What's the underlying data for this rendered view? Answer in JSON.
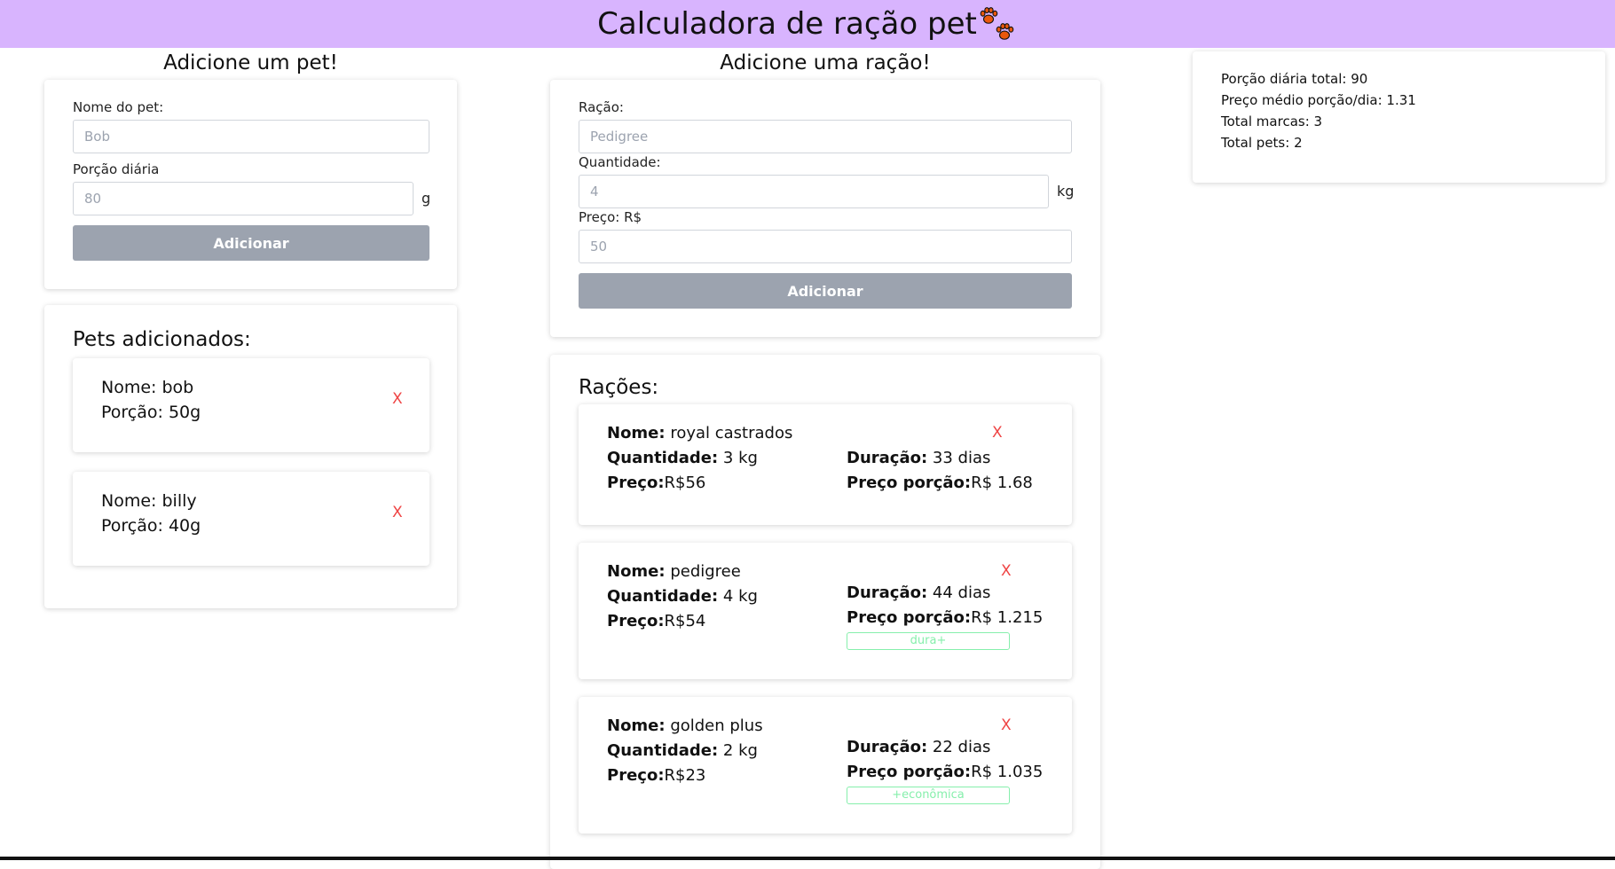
{
  "header": {
    "title": "Calculadora de ração pet"
  },
  "pet_form": {
    "heading": "Adicione um pet!",
    "name_label": "Nome do pet:",
    "name_placeholder": "Bob",
    "portion_label": "Porção diária",
    "portion_placeholder": "80",
    "portion_unit": "g",
    "submit_label": "Adicionar"
  },
  "pets_list": {
    "heading": "Pets adicionados:",
    "items": [
      {
        "name_line": "Nome: bob",
        "portion_line": "Porção: 50g",
        "remove": "X"
      },
      {
        "name_line": "Nome: billy",
        "portion_line": "Porção: 40g",
        "remove": "X"
      }
    ]
  },
  "food_form": {
    "heading": "Adicione uma ração!",
    "food_label": "Ração:",
    "food_placeholder": "Pedigree",
    "qty_label": "Quantidade:",
    "qty_placeholder": "4",
    "qty_unit": "kg",
    "price_label": "Preço: R$",
    "price_placeholder": "50",
    "submit_label": "Adicionar"
  },
  "foods_list": {
    "heading": "Rações:",
    "labels": {
      "name": "Nome:",
      "qty": "Quantidade:",
      "price": "Preço:",
      "duration": "Duração:",
      "portion_price": "Preço porção:"
    },
    "items": [
      {
        "name": " royal castrados",
        "qty": " 3 kg",
        "price": "R$56",
        "duration": " 33 dias",
        "portion_price": "R$ 1.68",
        "tag": "",
        "remove": "X"
      },
      {
        "name": " pedigree",
        "qty": " 4 kg",
        "price": "R$54",
        "duration": " 44 dias",
        "portion_price": "R$ 1.215",
        "tag": "dura+",
        "remove": "X"
      },
      {
        "name": " golden plus",
        "qty": " 2 kg",
        "price": "R$23",
        "duration": " 22 dias",
        "portion_price": "R$ 1.035",
        "tag": "+econômica",
        "remove": "X"
      }
    ]
  },
  "summary": {
    "total_portion": "Porção diária total: 90",
    "avg_price": "Preço médio porção/dia: 1.31",
    "total_brands": "Total marcas: 3",
    "total_pets": "Total pets: 2"
  },
  "colors": {
    "header_bg": "#d8b4fe",
    "button_bg": "#9ca3af",
    "remove": "#ef4444",
    "tag": "#86efac"
  }
}
